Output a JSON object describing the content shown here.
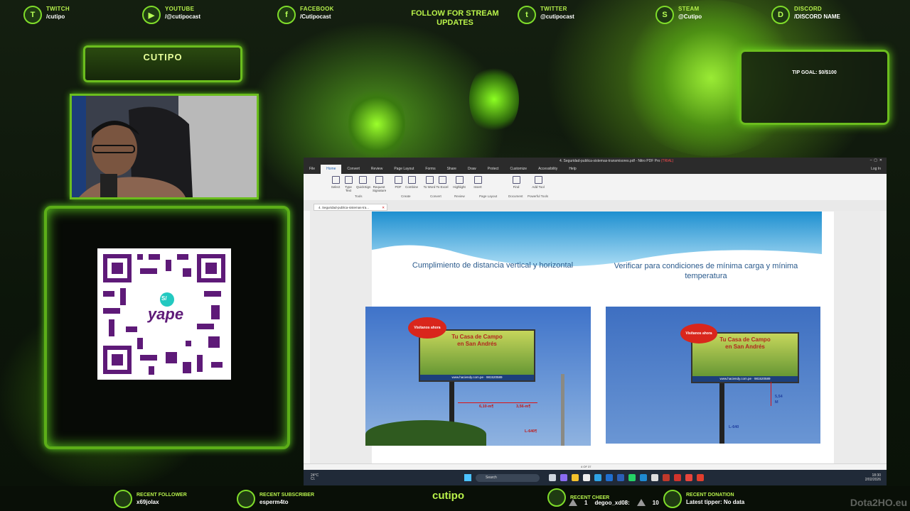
{
  "overlay": {
    "socials": [
      {
        "key": "twitch",
        "label": "TWITCH",
        "handle": "/cutipo"
      },
      {
        "key": "youtube",
        "label": "YOUTUBE",
        "handle": "/@cutipocast"
      },
      {
        "key": "facebook",
        "label": "FACEBOOK",
        "handle": "/Cutipocast"
      },
      {
        "key": "twitter",
        "label": "TWITTER",
        "handle": "@cutipocast"
      },
      {
        "key": "steam",
        "label": "STEAM",
        "handle": "@Cutipo"
      },
      {
        "key": "discord",
        "label": "DISCORD",
        "handle": "/DISCORD NAME"
      }
    ],
    "follow_text": "FOLLOW FOR STREAM UPDATES",
    "streamer_name": "CUTIPO",
    "qr_brand": "yape",
    "qr_symbol": "S/",
    "tip_goal": "TIP GOAL: $0/$100",
    "bottom": {
      "recent_follower_label": "RECENT FOLLOWER",
      "recent_follower": "x69jolax",
      "recent_subscriber_label": "RECENT SUBSCRIBER",
      "recent_subscriber": "esperm4to",
      "channel": "cutipo",
      "recent_cheer_label": "RECENT CHEER",
      "cheer_amount": "1",
      "cheer_user": "degoo_xd08:",
      "cheer_amount_2": "10",
      "recent_donation_label": "RECENT DONATION",
      "latest_tipper": "Latest tipper: No data",
      "watermark": "Dota2HO.eu"
    }
  },
  "pdf_app": {
    "title": "4. Seguridad-publica-sistemas-transmisores.pdf - Nitro PDF Pro",
    "license": "(TRIAL)",
    "menu": [
      "File",
      "Home",
      "Convert",
      "Review",
      "Page Layout",
      "Forms",
      "Share",
      "Draw",
      "Protect",
      "Customize",
      "Accessibility",
      "Help"
    ],
    "login": "Log In",
    "ribbon_groups": [
      "Tools",
      "Create",
      "Convert",
      "Review",
      "Page Layout",
      "Document",
      "Powerful Tools"
    ],
    "ribbon_buttons": [
      "Select",
      "Type Text",
      "QuickSign",
      "Request Signature",
      "PDF",
      "Combine",
      "To Word",
      "To Excel",
      "Highlight",
      "Insert",
      "Find",
      "Add Tool"
    ],
    "doc_tab": "4. Seguridad-publica-sistemas-tra...",
    "page_indicator": "4 OF 37",
    "slide": {
      "left_title": "Cumplimiento de distancia vertical y horizontal",
      "right_title": "Verificar para condiciones de mínima carga y mínima temperatura",
      "billboard_badge": "Visítanos ahora",
      "billboard_title_1": "Tu Casa de Campo",
      "billboard_title_2": "en San Andrés",
      "billboard_footer_left": "www.haciendy.com.pe",
      "billboard_footer_right": "981520589",
      "left_measure_1": "6,10-m¶",
      "left_measure_2": "3,56-m¶",
      "left_line": "L-640¶",
      "right_measure": "5,54",
      "right_measure_unit": "M",
      "right_line": "L-640"
    },
    "taskbar": {
      "weather": "24°C",
      "weather_sub": "Cl.",
      "search": "Search",
      "time": "18:30",
      "date": "2/02/2026"
    }
  }
}
